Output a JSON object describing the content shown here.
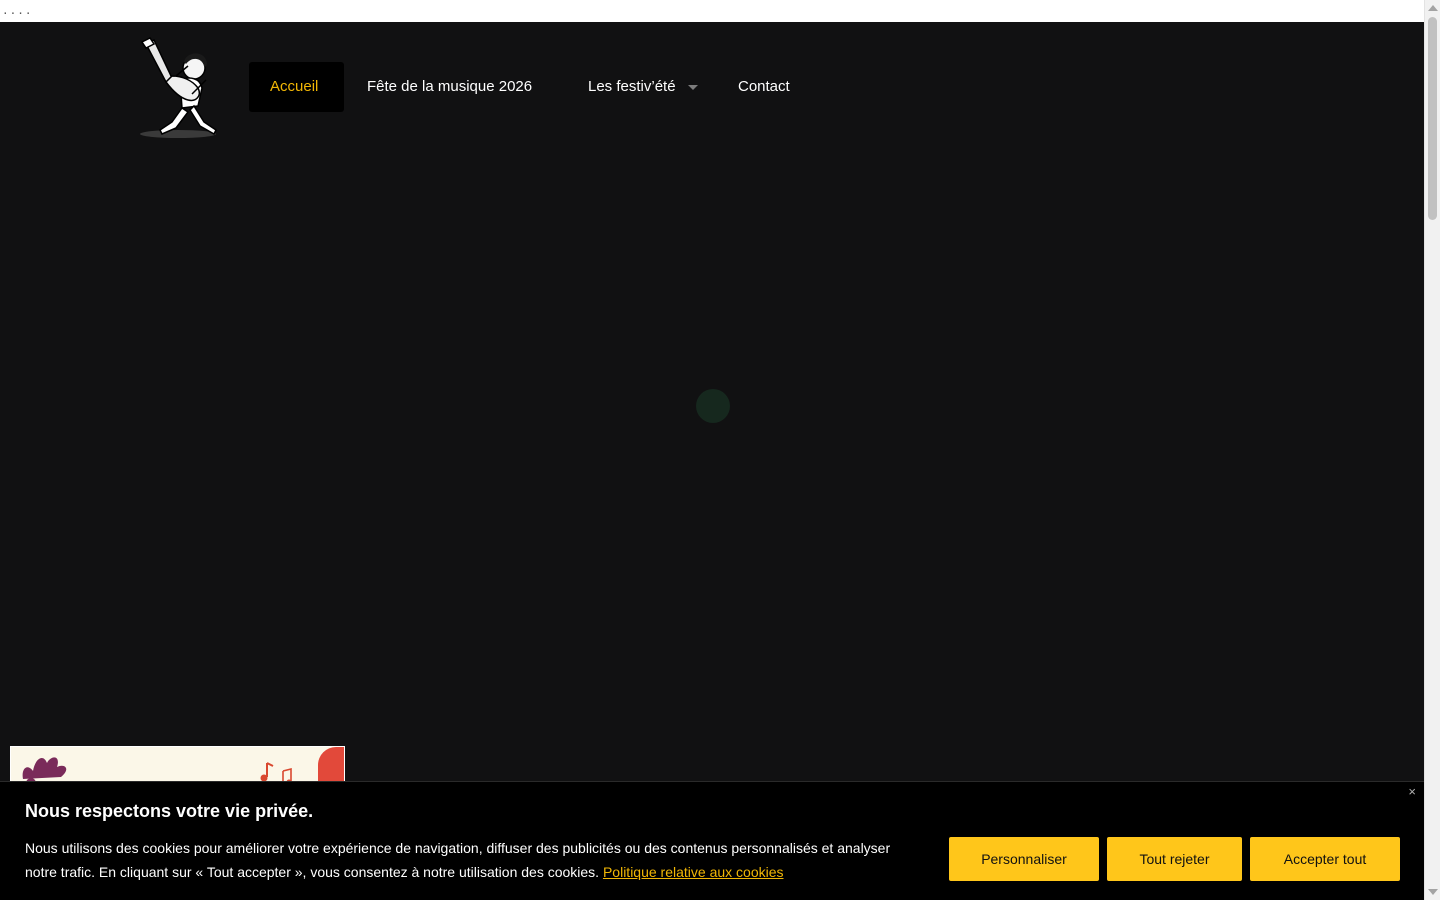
{
  "browser": {
    "top_dots": "...."
  },
  "logo": {
    "icon": "guitarist-logo-icon"
  },
  "nav": {
    "items": [
      {
        "label": "Accueil",
        "active": true
      },
      {
        "label": "Fête de la musique 2026"
      },
      {
        "label": "Les festiv’été",
        "has_dropdown": true
      },
      {
        "label": "Contact"
      }
    ]
  },
  "colors": {
    "page_bg": "#111112",
    "accent": "#f2b705",
    "button_bg": "#ffc61a",
    "cookie_bg": "#000000"
  },
  "cookie": {
    "title": "Nous respectons votre vie privée.",
    "text": "Nous utilisons des cookies pour améliorer votre expérience de navigation, diffuser des publicités ou des contenus personnalisés et analyser notre trafic. En cliquant sur « Tout accepter », vous consentez à notre utilisation des cookies.",
    "link": "Politique relative aux cookies",
    "close": "×",
    "buttons": {
      "customize": "Personnaliser",
      "reject": "Tout rejeter",
      "accept": "Accepter tout"
    }
  }
}
